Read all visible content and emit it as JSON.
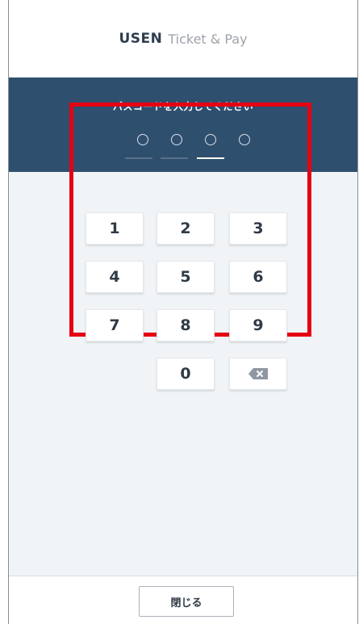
{
  "header": {
    "brand": "USEN",
    "product": "Ticket & Pay"
  },
  "passcode": {
    "title": "パスコードを入力してください",
    "digits_count": 4,
    "active_index": 2
  },
  "keypad": {
    "keys": [
      "1",
      "2",
      "3",
      "4",
      "5",
      "6",
      "7",
      "8",
      "9",
      "0"
    ],
    "backspace_icon": "backspace-icon"
  },
  "footer": {
    "close_label": "閉じる"
  },
  "colors": {
    "panel": "#2f4f6f",
    "background": "#f1f4f7",
    "highlight": "#e60012"
  }
}
